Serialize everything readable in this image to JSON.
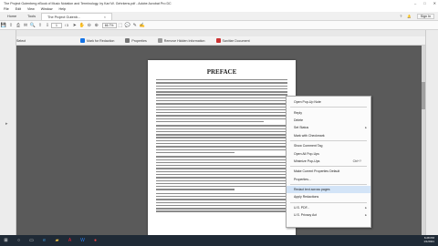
{
  "window": {
    "title": "The Project Gutenberg eBook of Music Notation and Terminology, by Karl W. Gehrkens.pdf - Adobe Acrobat Pro DC"
  },
  "menu": [
    "File",
    "Edit",
    "View",
    "Window",
    "Help"
  ],
  "tabs": {
    "home": "Home",
    "tools": "Tools",
    "document": "The Project Gutenb...",
    "close": "×"
  },
  "header_right": {
    "help": "?",
    "signin": "Sign In"
  },
  "toolbar": {
    "page_current": "1",
    "page_total": "/ 3",
    "zoom": "66.7%"
  },
  "tools_row": {
    "mode": "Select",
    "highlight": "Mark for Redaction",
    "properties": "Properties",
    "remove_hidden": "Remove Hidden Information",
    "sanitize": "Sanitize Document"
  },
  "document": {
    "heading": "PREFACE"
  },
  "context_menu": {
    "items": [
      {
        "label": "Open Pop-Up Note",
        "shortcut": ""
      },
      {
        "label": "Reply",
        "shortcut": ""
      },
      {
        "label": "Delete",
        "shortcut": ""
      },
      {
        "label": "Set Status",
        "shortcut": "",
        "submenu": true
      },
      {
        "label": "Mark with Checkmark",
        "shortcut": ""
      },
      {
        "label": "Show Comment Tag",
        "shortcut": ""
      },
      {
        "label": "Open All Pop-Ups",
        "shortcut": ""
      },
      {
        "label": "Minimize Pop-Ups",
        "shortcut": "Ctrl+?"
      },
      {
        "label": "Make Current Properties Default",
        "shortcut": ""
      },
      {
        "label": "Properties...",
        "shortcut": ""
      },
      {
        "label": "Redact text across pages",
        "shortcut": ""
      },
      {
        "label": "Apply Redactions",
        "shortcut": ""
      },
      {
        "label": "U.S. PDF...",
        "shortcut": "",
        "submenu": true
      },
      {
        "label": "U.S. Privacy Act",
        "shortcut": "",
        "submenu": true
      }
    ]
  },
  "taskbar": {
    "time": "6:28 PM",
    "date": "1/1/2021"
  },
  "colors": {
    "accent": "#1473e6",
    "taskbar": "#1f2a36",
    "highlight": "#d3e4f7"
  }
}
